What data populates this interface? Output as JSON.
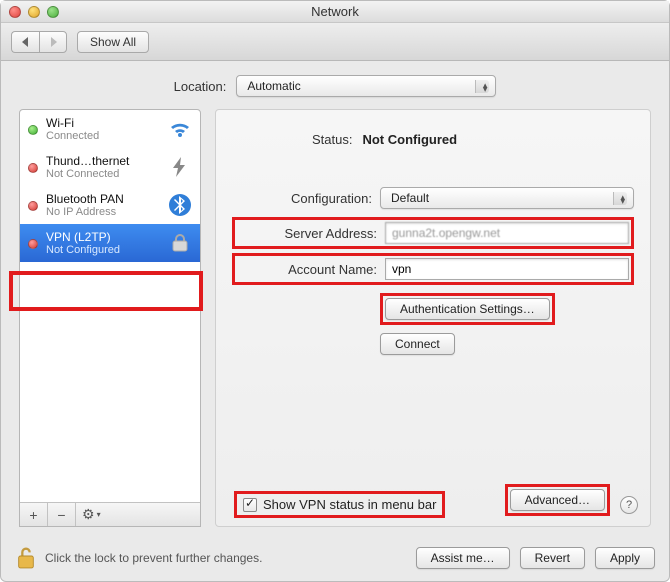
{
  "window": {
    "title": "Network"
  },
  "toolbar": {
    "show_all": "Show All"
  },
  "location": {
    "label": "Location:",
    "value": "Automatic"
  },
  "sidebar": {
    "items": [
      {
        "name": "Wi-Fi",
        "sub": "Connected",
        "status": "green",
        "kind": "wifi"
      },
      {
        "name": "Thund…thernet",
        "sub": "Not Connected",
        "status": "red",
        "kind": "thunderbolt"
      },
      {
        "name": "Bluetooth PAN",
        "sub": "No IP Address",
        "status": "red",
        "kind": "bluetooth"
      },
      {
        "name": "VPN (L2TP)",
        "sub": "Not Configured",
        "status": "red",
        "kind": "vpn",
        "selected": true
      }
    ],
    "tools": {
      "add": "+",
      "remove": "−",
      "gear": "⚙︎"
    }
  },
  "detail": {
    "status_label": "Status:",
    "status_value": "Not Configured",
    "config_label": "Configuration:",
    "config_value": "Default",
    "server_label": "Server Address:",
    "server_value": "gunna2t.opengw.net",
    "account_label": "Account Name:",
    "account_value": "vpn",
    "auth_btn": "Authentication Settings…",
    "connect_btn": "Connect",
    "show_status_label": "Show VPN status in menu bar",
    "show_status_checked": true,
    "advanced_btn": "Advanced…",
    "help": "?"
  },
  "footer": {
    "lock_text": "Click the lock to prevent further changes.",
    "assist": "Assist me…",
    "revert": "Revert",
    "apply": "Apply"
  }
}
